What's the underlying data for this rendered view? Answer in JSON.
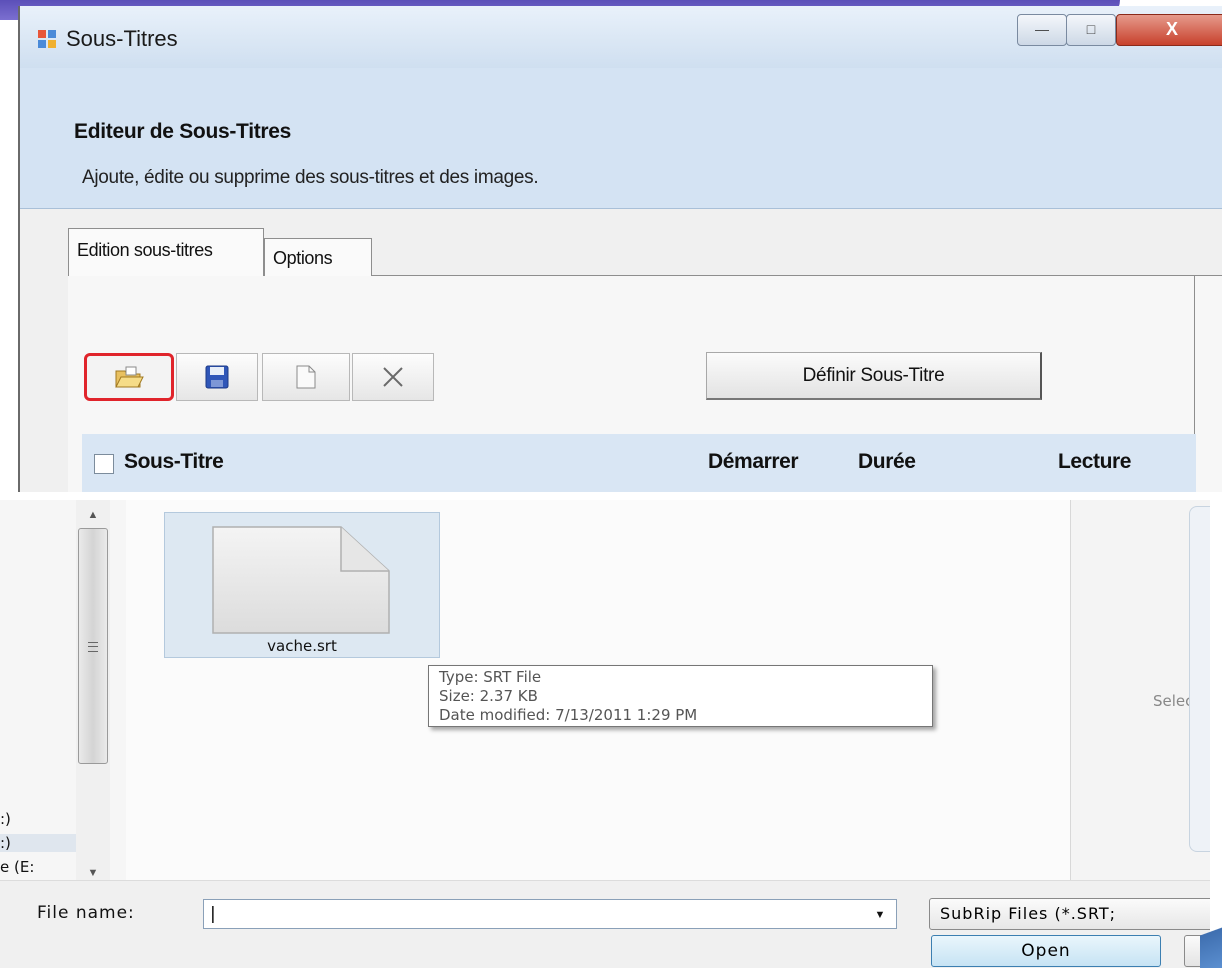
{
  "window": {
    "title": "Sous-Titres",
    "controls": {
      "minimize": "—",
      "maximize": "□",
      "close": "X"
    }
  },
  "header": {
    "title": "Editeur de Sous-Titres",
    "subtitle": "Ajoute, édite ou supprime des sous-titres et des images."
  },
  "tabs": [
    {
      "label": "Edition sous-titres",
      "active": true
    },
    {
      "label": "Options",
      "active": false
    }
  ],
  "toolbar": {
    "buttons": [
      {
        "name": "open",
        "icon": "folder-open-icon",
        "highlighted": true
      },
      {
        "name": "save",
        "icon": "floppy-disk-icon"
      },
      {
        "name": "new",
        "icon": "blank-document-icon"
      },
      {
        "name": "delete",
        "icon": "x-icon"
      }
    ],
    "define_label": "Définir Sous-Titre"
  },
  "subtitle_list": {
    "columns": [
      "Sous-Titre",
      "Démarrer",
      "Durée",
      "Lecture"
    ]
  },
  "file_dialog": {
    "drives": [
      ":)",
      ":)",
      "e (E:"
    ],
    "files": [
      {
        "name": "vache.srt",
        "icon": "document-icon"
      }
    ],
    "tooltip": {
      "type": "Type: SRT File",
      "size": "Size: 2.37 KB",
      "modified": "Date modified: 7/13/2011 1:29 PM"
    },
    "preview_text": "Selec",
    "file_name_label": "File name:",
    "file_name_value": "|",
    "filter_value": "SubRip Files (*.SRT;",
    "open_label": "Open"
  },
  "colors": {
    "highlight": "#e0242b",
    "header_band": "#d4e3f3",
    "list_header": "#d9e6f4",
    "open_button": "#c6e3f4"
  }
}
